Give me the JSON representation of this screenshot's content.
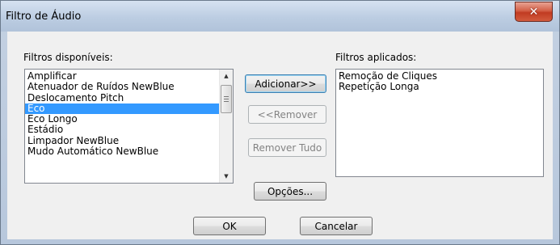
{
  "window": {
    "title": "Filtro de Áudio",
    "close_glyph": "✕"
  },
  "available": {
    "label": "Filtros disponíveis:",
    "items": [
      "Amplificar",
      "Atenuador de Ruídos NewBlue",
      "Deslocamento Pitch",
      "Eco",
      "Eco Longo",
      "Estádio",
      "Limpador NewBlue",
      "Mudo Automático NewBlue"
    ],
    "selected_index": 3
  },
  "applied": {
    "label": "Filtros aplicados:",
    "items": [
      "Remoção de Cliques",
      "Repetição Longa"
    ]
  },
  "buttons": {
    "add": "Adicionar>>",
    "remove": "<<Remover",
    "remove_all": "Remover Tudo",
    "options": "Opções...",
    "ok": "OK",
    "cancel": "Cancelar"
  }
}
